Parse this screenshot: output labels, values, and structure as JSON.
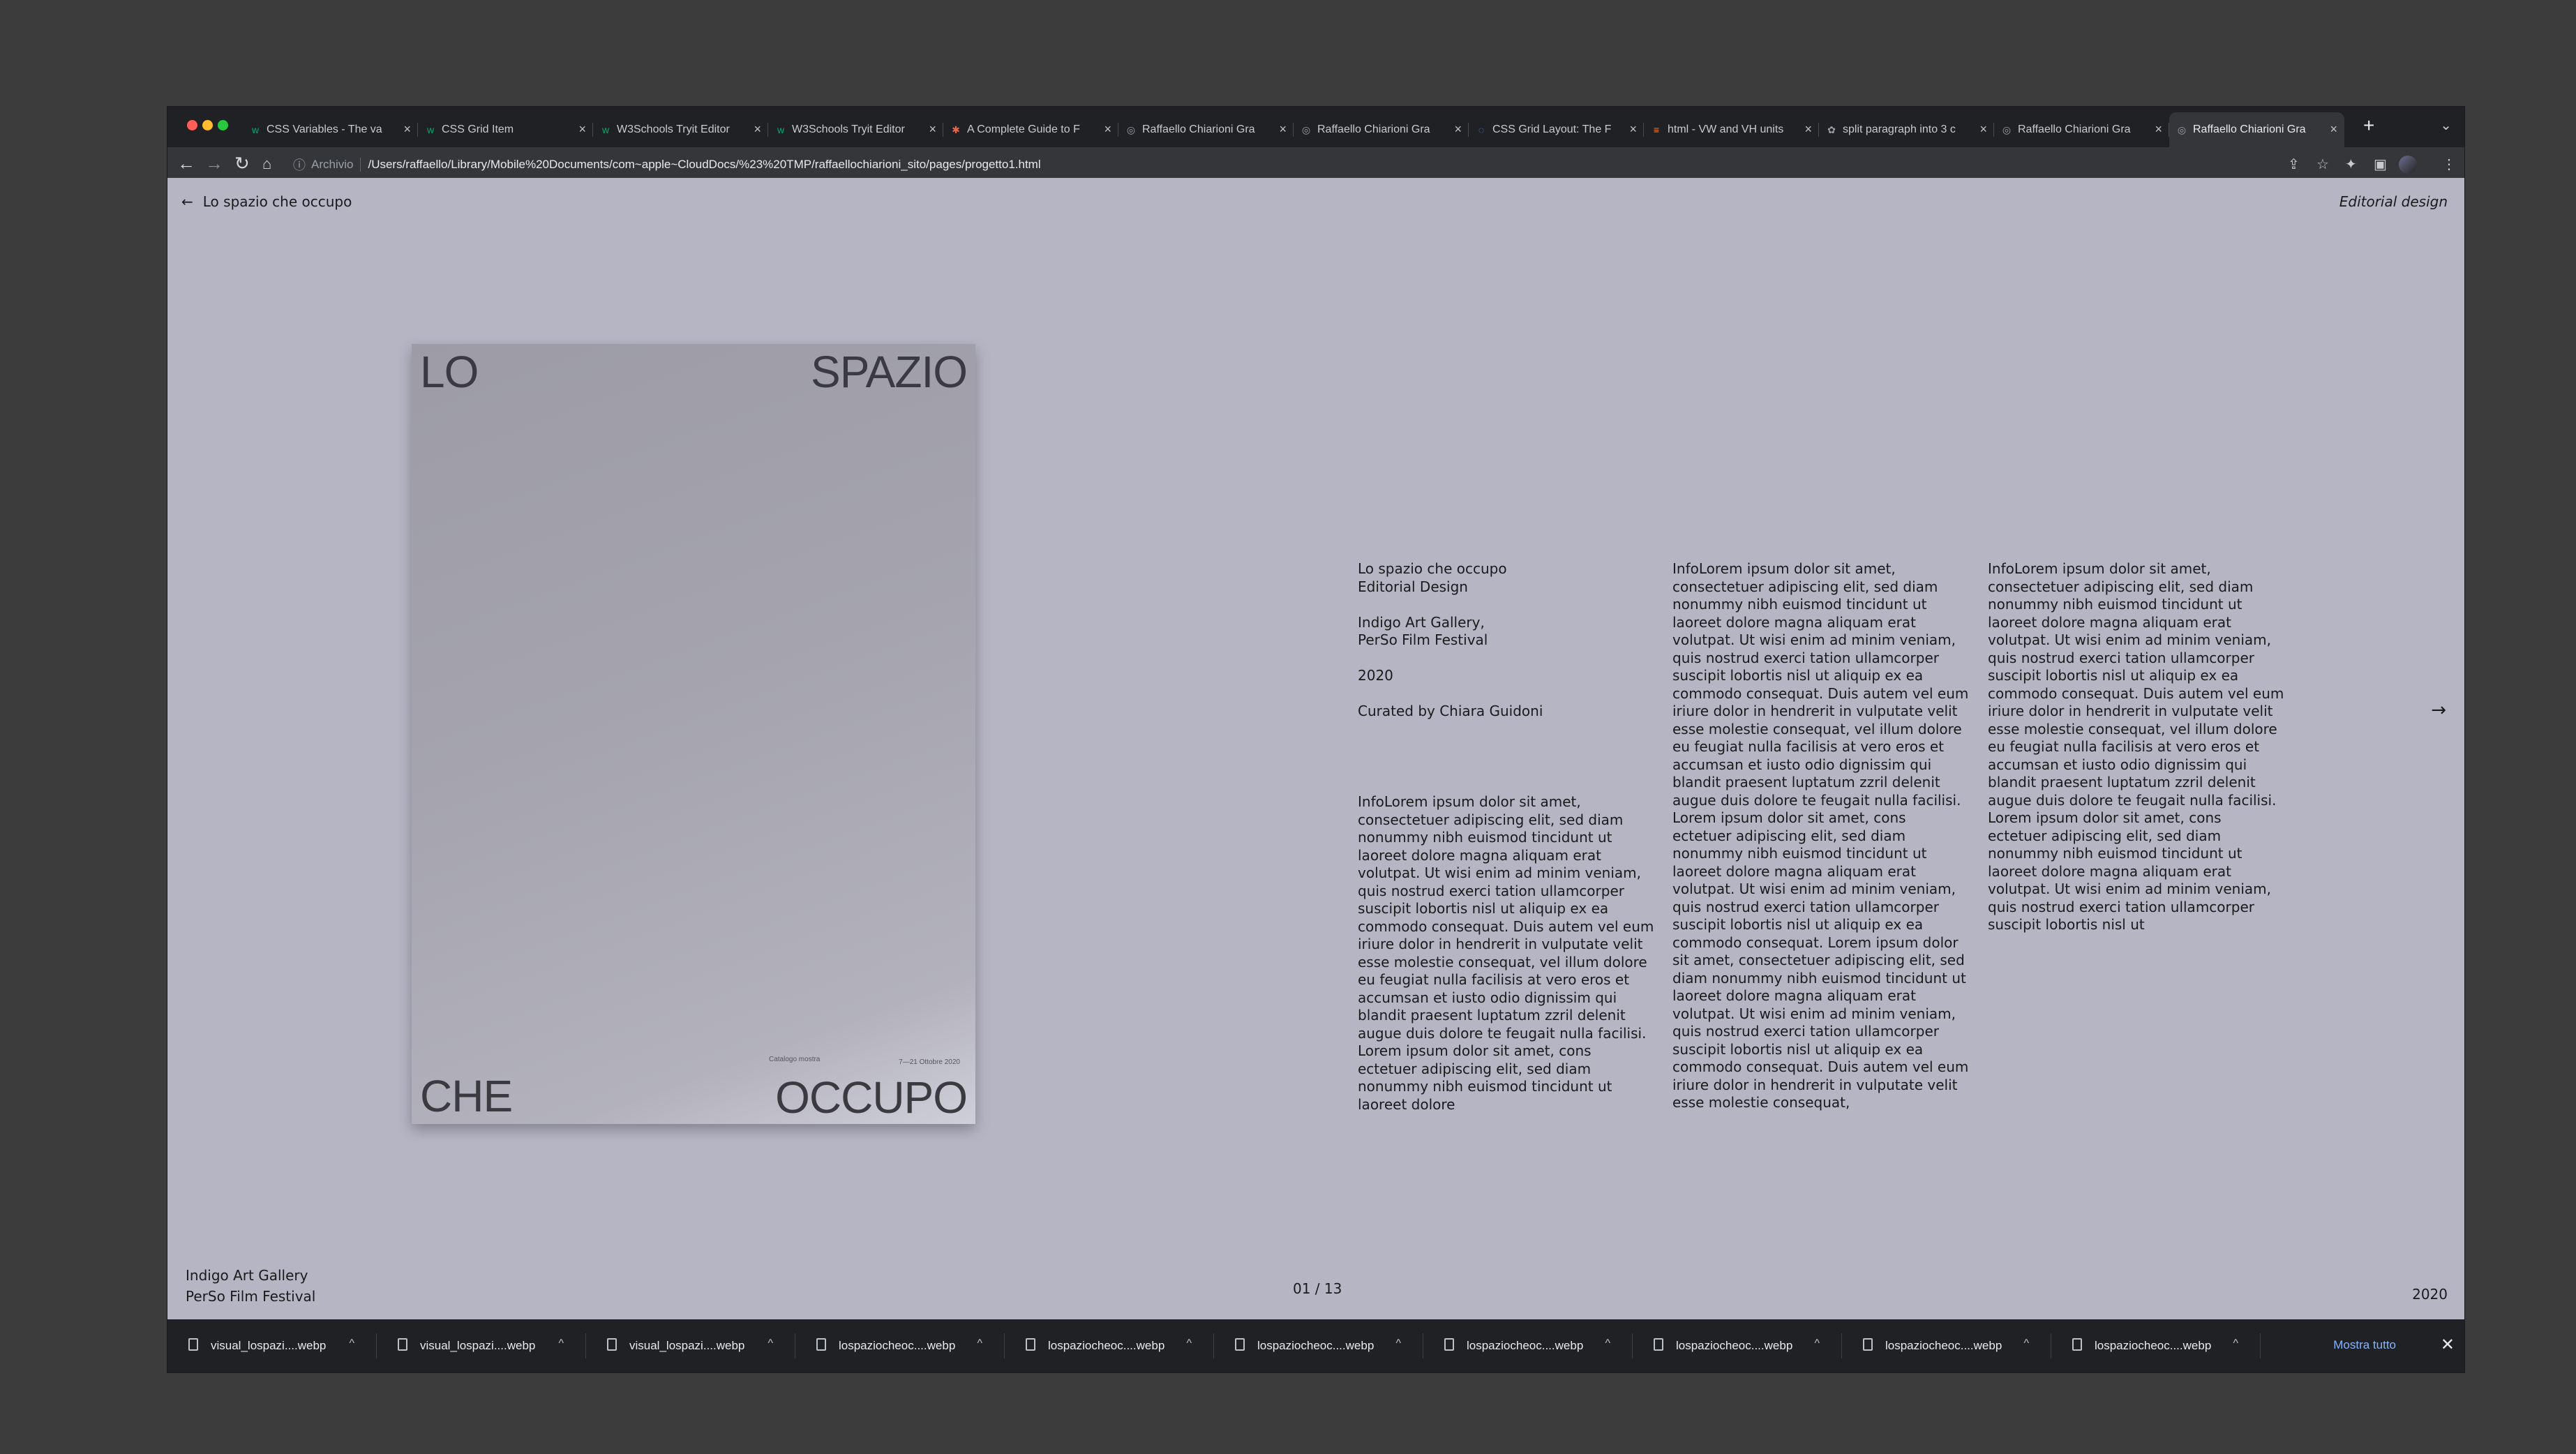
{
  "browser": {
    "colors": {
      "red": "#ff5f57",
      "yellow": "#febc2e",
      "green": "#28c840",
      "page_bg": "#b6b5c4"
    },
    "tabs": [
      {
        "title": "CSS Variables - The va",
        "icon": "w-icon"
      },
      {
        "title": "CSS Grid Item",
        "icon": "w-icon"
      },
      {
        "title": "W3Schools Tryit Editor",
        "icon": "w-icon"
      },
      {
        "title": "W3Schools Tryit Editor",
        "icon": "w-icon"
      },
      {
        "title": "A Complete Guide to F",
        "icon": "asterisk-icon"
      },
      {
        "title": "Raffaello Chiarioni Gra",
        "icon": "globe-icon"
      },
      {
        "title": "Raffaello Chiarioni Gra",
        "icon": "globe-icon"
      },
      {
        "title": "CSS Grid Layout: The F",
        "icon": "circle-icon"
      },
      {
        "title": "html - VW and VH units",
        "icon": "stack-icon"
      },
      {
        "title": "split paragraph into 3 c",
        "icon": "openai-icon"
      },
      {
        "title": "Raffaello Chiarioni Gra",
        "icon": "globe-icon"
      },
      {
        "title": "Raffaello Chiarioni Gra",
        "icon": "globe-icon",
        "active": true
      }
    ],
    "address": {
      "scheme_label": "Archivio",
      "url": "/Users/raffaello/Library/Mobile%20Documents/com~apple~CloudDocs/%23%20TMP/raffaellochiarioni_sito/pages/progetto1.html"
    }
  },
  "page": {
    "back_label": "Lo spazio che occupo",
    "category": "Editorial design",
    "next_icon": "arrow-right-icon",
    "poster": {
      "word_tl": "LO",
      "word_tr": "SPAZIO",
      "word_bl": "CHE",
      "word_br": "OCCUPO",
      "small_left": "Catalogo mostra",
      "small_right": "7—21 Ottobre 2020"
    },
    "details": {
      "title": "Lo spazio che occupo",
      "type": "Editorial Design",
      "client_1": "Indigo Art Gallery,",
      "client_2": "PerSo Film Festival",
      "year": "2020",
      "curator": "Curated by Chiara Guidoni"
    },
    "text_col1": "InfoLorem ipsum dolor sit amet, consectetuer adipiscing elit, sed diam nonummy nibh euismod tincidunt ut laoreet dolore magna aliquam erat volutpat. Ut wisi enim ad minim veniam, quis nostrud exerci tation ullamcorper suscipit lobortis nisl ut aliquip ex ea commodo consequat. Duis autem vel eum iriure dolor in hendrerit in vulputate velit esse molestie consequat, vel illum dolore eu feugiat nulla facilisis at vero eros et accumsan et iusto odio dignissim qui blandit praesent luptatum zzril delenit augue duis dolore te feugait nulla facilisi. Lorem ipsum dolor sit amet, cons ectetuer adipiscing elit, sed diam nonummy nibh euismod tincidunt ut laoreet dolore",
    "text_col2": "InfoLorem ipsum dolor sit amet, consectetuer adipiscing elit, sed diam nonummy nibh euismod tincidunt ut laoreet dolore magna aliquam erat volutpat. Ut wisi enim ad minim veniam, quis nostrud exerci tation ullamcorper suscipit lobortis nisl ut aliquip ex ea commodo consequat. Duis autem vel eum iriure dolor in hendrerit in vulputate velit esse molestie consequat, vel illum dolore eu feugiat nulla facilisis at vero eros et accumsan et iusto odio dignissim qui blandit praesent luptatum zzril delenit augue duis dolore te feugait nulla facilisi. Lorem ipsum dolor sit amet, cons ectetuer adipiscing elit, sed diam nonummy nibh euismod tincidunt ut laoreet dolore magna aliquam erat volutpat. Ut wisi enim ad minim veniam, quis nostrud exerci tation ullamcorper suscipit lobortis nisl ut aliquip ex ea commodo consequat. Lorem ipsum dolor sit amet, consectetuer adipiscing elit, sed diam nonummy nibh euismod tincidunt ut laoreet dolore magna aliquam erat volutpat. Ut wisi enim ad minim veniam, quis nostrud exerci tation ullamcorper suscipit lobortis nisl ut aliquip ex ea commodo consequat. Duis autem vel eum iriure dolor in hendrerit in vulputate velit esse molestie consequat,",
    "text_col3": "InfoLorem ipsum dolor sit amet, consectetuer adipiscing elit, sed diam nonummy nibh euismod tincidunt ut laoreet dolore magna aliquam erat volutpat. Ut wisi enim ad minim veniam, quis nostrud exerci tation ullamcorper suscipit lobortis nisl ut aliquip ex ea commodo consequat. Duis autem vel eum iriure dolor in hendrerit in vulputate velit esse molestie consequat, vel illum dolore eu feugiat nulla facilisis at vero eros et accumsan et iusto odio dignissim qui blandit praesent luptatum zzril delenit augue duis dolore te feugait nulla facilisi. Lorem ipsum dolor sit amet, cons ectetuer adipiscing elit, sed diam nonummy nibh euismod tincidunt ut laoreet dolore magna aliquam erat volutpat. Ut wisi enim ad minim veniam, quis nostrud exerci tation ullamcorper suscipit lobortis nisl ut",
    "footer": {
      "gallery": "Indigo Art Gallery",
      "festival": "PerSo Film Festival",
      "pager": "01 / 13",
      "year": "2020"
    }
  },
  "downloads": {
    "items": [
      "visual_lospazi....webp",
      "visual_lospazi....webp",
      "visual_lospazi....webp",
      "lospaziocheoc....webp",
      "lospaziocheoc....webp",
      "lospaziocheoc....webp",
      "lospaziocheoc....webp",
      "lospaziocheoc....webp",
      "lospaziocheoc....webp",
      "lospaziocheoc....webp"
    ],
    "show_all": "Mostra tutto"
  }
}
